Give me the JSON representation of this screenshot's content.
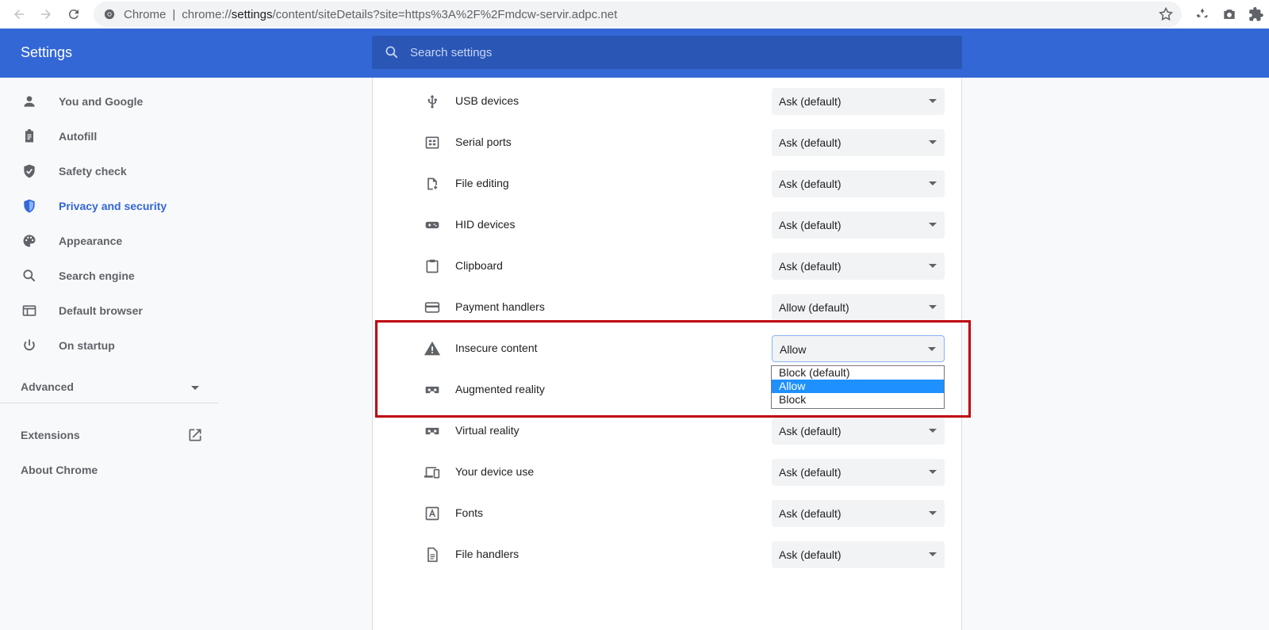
{
  "browser": {
    "scheme_label": "Chrome",
    "separator": "|",
    "url_prefix": "chrome://",
    "url_host": "settings",
    "url_rest": "/content/siteDetails?site=https%3A%2F%2Fmdcw-servir.adpc.net",
    "icons": [
      "back-icon",
      "forward-icon",
      "reload-icon",
      "bookmark-star-icon",
      "recycle-extension-icon",
      "camera-extension-icon",
      "puzzle-extension-icon"
    ]
  },
  "header": {
    "title": "Settings",
    "search_placeholder": "Search settings"
  },
  "sidebar": {
    "items": [
      {
        "label": "You and Google",
        "icon": "person-icon"
      },
      {
        "label": "Autofill",
        "icon": "clipboard-icon"
      },
      {
        "label": "Safety check",
        "icon": "shield-check-icon"
      },
      {
        "label": "Privacy and security",
        "icon": "shield-icon",
        "active": true
      },
      {
        "label": "Appearance",
        "icon": "palette-icon"
      },
      {
        "label": "Search engine",
        "icon": "search-icon"
      },
      {
        "label": "Default browser",
        "icon": "browser-window-icon"
      },
      {
        "label": "On startup",
        "icon": "power-icon"
      }
    ],
    "advanced_label": "Advanced",
    "extensions_label": "Extensions",
    "about_label": "About Chrome"
  },
  "permissions": [
    {
      "label": "USB devices",
      "value": "Ask (default)",
      "icon": "usb-icon"
    },
    {
      "label": "Serial ports",
      "value": "Ask (default)",
      "icon": "serial-port-icon"
    },
    {
      "label": "File editing",
      "value": "Ask (default)",
      "icon": "file-edit-icon"
    },
    {
      "label": "HID devices",
      "value": "Ask (default)",
      "icon": "gamepad-icon"
    },
    {
      "label": "Clipboard",
      "value": "Ask (default)",
      "icon": "clipboard-icon"
    },
    {
      "label": "Payment handlers",
      "value": "Allow (default)",
      "icon": "credit-card-icon"
    },
    {
      "label": "Insecure content",
      "value": "Allow",
      "icon": "warning-icon"
    },
    {
      "label": "Augmented reality",
      "value": "",
      "icon": "vr-headset-icon"
    },
    {
      "label": "Virtual reality",
      "value": "Ask (default)",
      "icon": "vr-headset-icon"
    },
    {
      "label": "Your device use",
      "value": "Ask (default)",
      "icon": "devices-icon"
    },
    {
      "label": "Fonts",
      "value": "Ask (default)",
      "icon": "font-icon"
    },
    {
      "label": "File handlers",
      "value": "Ask (default)",
      "icon": "document-icon"
    }
  ],
  "dropdown": {
    "options": [
      "Block (default)",
      "Allow",
      "Block"
    ],
    "selected_index": 1
  },
  "colors": {
    "accent": "#3367d6",
    "highlight_border": "#c00010",
    "dropdown_selected": "#1e90ff"
  }
}
